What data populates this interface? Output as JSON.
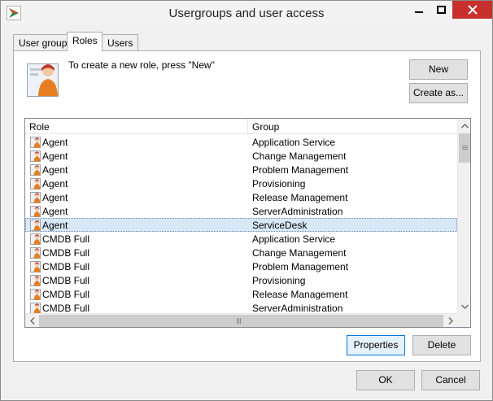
{
  "window": {
    "title": "Usergroups and user access",
    "icon": "app-logo-icon",
    "controls": [
      "minimize-icon",
      "maximize-icon",
      "close-icon"
    ]
  },
  "tabs": [
    {
      "label": "User group",
      "active": false
    },
    {
      "label": "Roles",
      "active": true
    },
    {
      "label": "Users",
      "active": false
    }
  ],
  "roles_panel": {
    "hint": "To create a new role, press \"New\"",
    "new_label": "New",
    "create_as_label": "Create as...",
    "columns": {
      "role": "Role",
      "group": "Group"
    },
    "rows": [
      {
        "role": "Agent",
        "group": "Application Service",
        "selected": false
      },
      {
        "role": "Agent",
        "group": "Change Management",
        "selected": false
      },
      {
        "role": "Agent",
        "group": "Problem Management",
        "selected": false
      },
      {
        "role": "Agent",
        "group": "Provisioning",
        "selected": false
      },
      {
        "role": "Agent",
        "group": "Release Management",
        "selected": false
      },
      {
        "role": "Agent",
        "group": "ServerAdministration",
        "selected": false
      },
      {
        "role": "Agent",
        "group": "ServiceDesk",
        "selected": true
      },
      {
        "role": "CMDB Full",
        "group": "Application Service",
        "selected": false
      },
      {
        "role": "CMDB Full",
        "group": "Change Management",
        "selected": false
      },
      {
        "role": "CMDB Full",
        "group": "Problem Management",
        "selected": false
      },
      {
        "role": "CMDB Full",
        "group": "Provisioning",
        "selected": false
      },
      {
        "role": "CMDB Full",
        "group": "Release Management",
        "selected": false
      },
      {
        "role": "CMDB Full",
        "group": "ServerAdministration",
        "selected": false
      }
    ],
    "properties_label": "Properties",
    "delete_label": "Delete"
  },
  "footer": {
    "ok_label": "OK",
    "cancel_label": "Cancel"
  },
  "colors": {
    "close_button": "#c7302c",
    "selection": "#d9e8f7",
    "focus_border": "#0078d7"
  }
}
